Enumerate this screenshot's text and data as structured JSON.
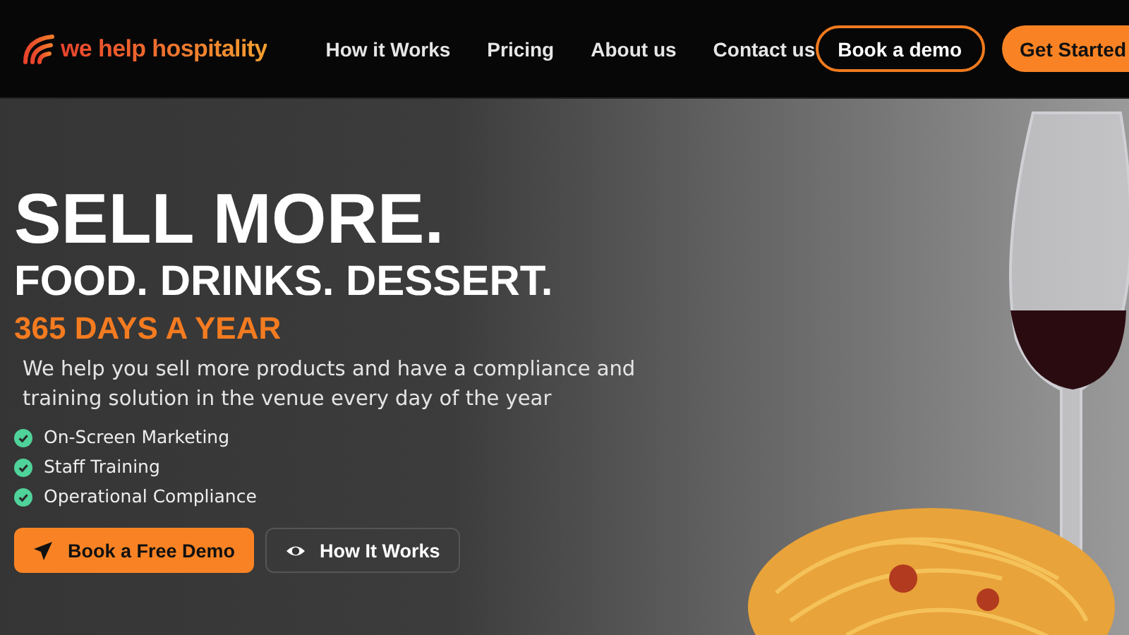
{
  "header": {
    "logo": "we help hospitality",
    "nav": [
      "How it Works",
      "Pricing",
      "About us",
      "Contact us"
    ],
    "buttons": [
      {
        "label": "Book a demo",
        "kind": "outline"
      },
      {
        "label": "Get Started",
        "kind": "filled"
      }
    ]
  },
  "hero": {
    "headline": "SELL MORE.",
    "subheadline": "FOOD. DRINKS. DESSERT.",
    "tagline": "365 DAYS A YEAR",
    "description": "We help you sell more products and have a compliance and training solution in the venue every day of the year",
    "features": [
      "On-Screen Marketing",
      "Staff Training",
      "Operational Compliance"
    ],
    "buttons": [
      {
        "label": "Book a Free Demo",
        "kind": "primary"
      },
      {
        "label": "How It Works",
        "kind": "secondary"
      }
    ]
  }
}
